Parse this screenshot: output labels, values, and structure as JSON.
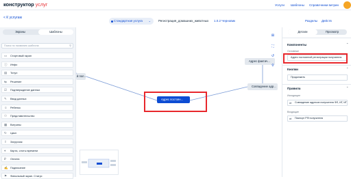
{
  "header": {
    "logo_main": "конструктор",
    "logo_accent": "услуг",
    "nav": [
      "Услуги",
      "Шаблоны",
      "Справочники витрин"
    ]
  },
  "subheader": {
    "back_label": "< К услугам",
    "service_select": "Стандартная услуга",
    "process_name": "Регистрация_домашних_животных",
    "version": "1.0.2 Черновик",
    "sections": "Разделы",
    "actions": "Действ"
  },
  "left_panel": {
    "tabs": [
      "Экраны",
      "Шаблоны"
    ],
    "search_placeholder": "Поиск по названию шаблона",
    "components": [
      {
        "label": "Стартовый экран",
        "icon": "▭"
      },
      {
        "label": "Инфо",
        "icon": "ⓘ"
      },
      {
        "label": "Титул",
        "icon": "▤"
      },
      {
        "label": "Решение",
        "icon": "⇆"
      },
      {
        "label": "Подтверждение данных",
        "icon": "☑"
      },
      {
        "label": "Ввод данных",
        "icon": "✎"
      },
      {
        "label": "Ребенок",
        "icon": "☺"
      },
      {
        "label": "Представительство",
        "icon": "⚇"
      },
      {
        "label": "Витрины",
        "icon": "▦"
      },
      {
        "label": "Цикл",
        "icon": "↻"
      },
      {
        "label": "Загрузчик",
        "icon": "⇪"
      },
      {
        "label": "Карта, слоты времени",
        "icon": "⌖"
      },
      {
        "label": "Оплата",
        "icon": "₽"
      },
      {
        "label": "Подписание",
        "icon": "✍"
      },
      {
        "label": "Финальный экран. Статус",
        "icon": "⚑"
      }
    ]
  },
  "canvas": {
    "nodes": {
      "left_partial": "й пол...",
      "center": "Адрес постоян...",
      "top_right": "Адрес фактич...",
      "right": "Совпадение адр..."
    },
    "tools": [
      "⊞",
      "⛶",
      "↺",
      "⚲"
    ]
  },
  "right_panel": {
    "tabs": [
      "Детали",
      "Просмотр"
    ],
    "components_title": "Компоненты",
    "basic_label": "Основные",
    "basic_value": "Адрес постоянной регистрации получателя",
    "buttons_title": "Кнопки",
    "button_value": "Продолжить",
    "rules_title": "Правила",
    "incoming_label": "Исходящие",
    "incoming_value": "Совпадение адресов получателя ФЛ, ИГ, ИП",
    "outgoing_label": "Входящие",
    "outgoing_value": "Паспорт РФ получателя"
  },
  "colors": {
    "accent": "#0d4cd3",
    "highlight": "#e8262b",
    "brand_red": "#e8383d"
  }
}
